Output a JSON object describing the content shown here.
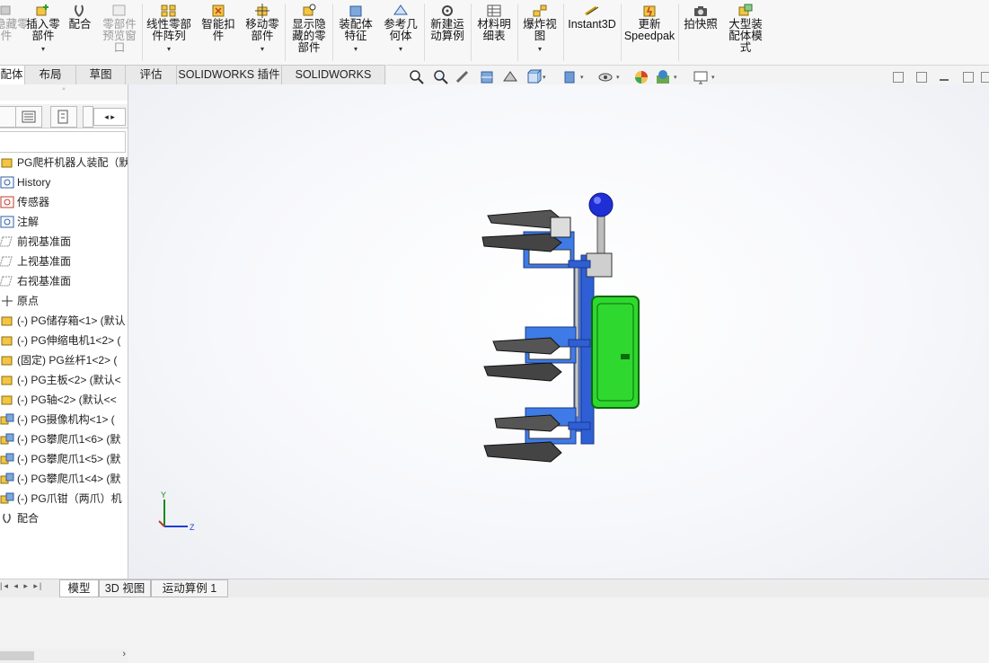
{
  "ribbon": {
    "items": [
      {
        "label": "隐藏零\n件",
        "icon": "hide-part-icon",
        "disabled": true
      },
      {
        "label": "插入零\n部件",
        "icon": "insert-component-icon"
      },
      {
        "label": "配合",
        "icon": "mate-icon"
      },
      {
        "label": "零部件\n预览窗\n口",
        "icon": "component-preview-icon",
        "disabled": true
      },
      {
        "label": "线性零部\n件阵列",
        "icon": "linear-pattern-icon"
      },
      {
        "label": "智能扣\n件",
        "icon": "smart-fastener-icon"
      },
      {
        "label": "移动零\n部件",
        "icon": "move-component-icon"
      },
      {
        "label": "显示隐\n藏的零\n部件",
        "icon": "show-hidden-icon"
      },
      {
        "label": "装配体\n特征",
        "icon": "assembly-feature-icon"
      },
      {
        "label": "参考几\n何体",
        "icon": "reference-geometry-icon"
      },
      {
        "label": "新建运\n动算例",
        "icon": "new-motion-study-icon"
      },
      {
        "label": "材料明\n细表",
        "icon": "bom-icon"
      },
      {
        "label": "爆炸视\n图",
        "icon": "exploded-view-icon"
      },
      {
        "label": "Instant3D",
        "icon": "instant3d-icon"
      },
      {
        "label": "更新\nSpeedpak",
        "icon": "speedpak-icon"
      },
      {
        "label": "拍快照",
        "icon": "snapshot-icon"
      },
      {
        "label": "大型装\n配体模\n式",
        "icon": "large-assembly-icon"
      }
    ]
  },
  "tabs": [
    "配体",
    "布局",
    "草图",
    "评估",
    "SOLIDWORKS 插件",
    "SOLIDWORKS MBD"
  ],
  "tree": {
    "root": "PG爬杆机器人装配（默认<",
    "items": [
      {
        "label": "History",
        "icon": "history-icon"
      },
      {
        "label": "传感器",
        "icon": "sensor-icon"
      },
      {
        "label": "注解",
        "icon": "annotation-icon"
      },
      {
        "label": "前视基准面",
        "icon": "plane-icon"
      },
      {
        "label": "上视基准面",
        "icon": "plane-icon"
      },
      {
        "label": "右视基准面",
        "icon": "plane-icon"
      },
      {
        "label": "原点",
        "icon": "origin-icon"
      },
      {
        "label": "(-) PG储存箱<1> (默认",
        "icon": "part-icon"
      },
      {
        "label": "(-) PG伸缩电机1<2> (",
        "icon": "part-icon"
      },
      {
        "label": "(固定) PG丝杆1<2> (",
        "icon": "part-icon"
      },
      {
        "label": "(-) PG主板<2> (默认<",
        "icon": "part-icon"
      },
      {
        "label": "(-) PG轴<2> (默认<<",
        "icon": "part-icon"
      },
      {
        "label": "(-) PG摄像机构<1> (",
        "icon": "subassembly-icon"
      },
      {
        "label": "(-) PG攀爬爪1<6> (默",
        "icon": "subassembly-icon"
      },
      {
        "label": "(-) PG攀爬爪1<5> (默",
        "icon": "subassembly-icon"
      },
      {
        "label": "(-) PG攀爬爪1<4> (默",
        "icon": "subassembly-icon"
      },
      {
        "label": "(-) PG爪钳（两爪）机",
        "icon": "subassembly-icon"
      },
      {
        "label": "配合",
        "icon": "mates-folder-icon"
      }
    ]
  },
  "bottom_tabs": [
    "模型",
    "3D 视图",
    "运动算例 1"
  ],
  "triad": {
    "y": "Y",
    "z": "Z"
  },
  "colors": {
    "accent": "#1f6fd0",
    "frame_blue": "#2e5fd4",
    "box_green": "#2fd82f",
    "ball_blue": "#1f2fd6"
  }
}
